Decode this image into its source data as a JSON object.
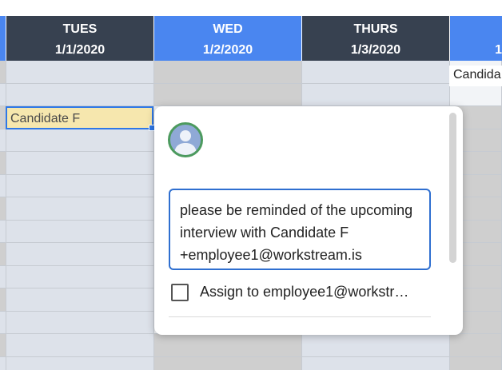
{
  "colors": {
    "header_dark": "#374150",
    "header_blue": "#4a86f0",
    "cell_light": "#dde2ea",
    "cell_grey": "#cfcfcf",
    "selected_cell": "#f6e7ae",
    "selection_border": "#2f78e6",
    "avatar_ring": "#4c9a5e"
  },
  "headers": [
    {
      "day": "",
      "date": ""
    },
    {
      "day": "TUES",
      "date": "1/1/2020"
    },
    {
      "day": "WED",
      "date": "1/2/2020"
    },
    {
      "day": "THURS",
      "date": "1/3/2020"
    },
    {
      "day": "",
      "date": "1"
    }
  ],
  "cells": {
    "selected": "Candidate F",
    "right_partial": "Candida"
  },
  "comment_popup": {
    "avatar_icon": "user-avatar-icon",
    "comment_text": "please be reminded of the upcoming interview with Candidate F +employee1@workstream.is",
    "assign_label": "Assign to employee1@workstr…",
    "assign_checked": false
  }
}
